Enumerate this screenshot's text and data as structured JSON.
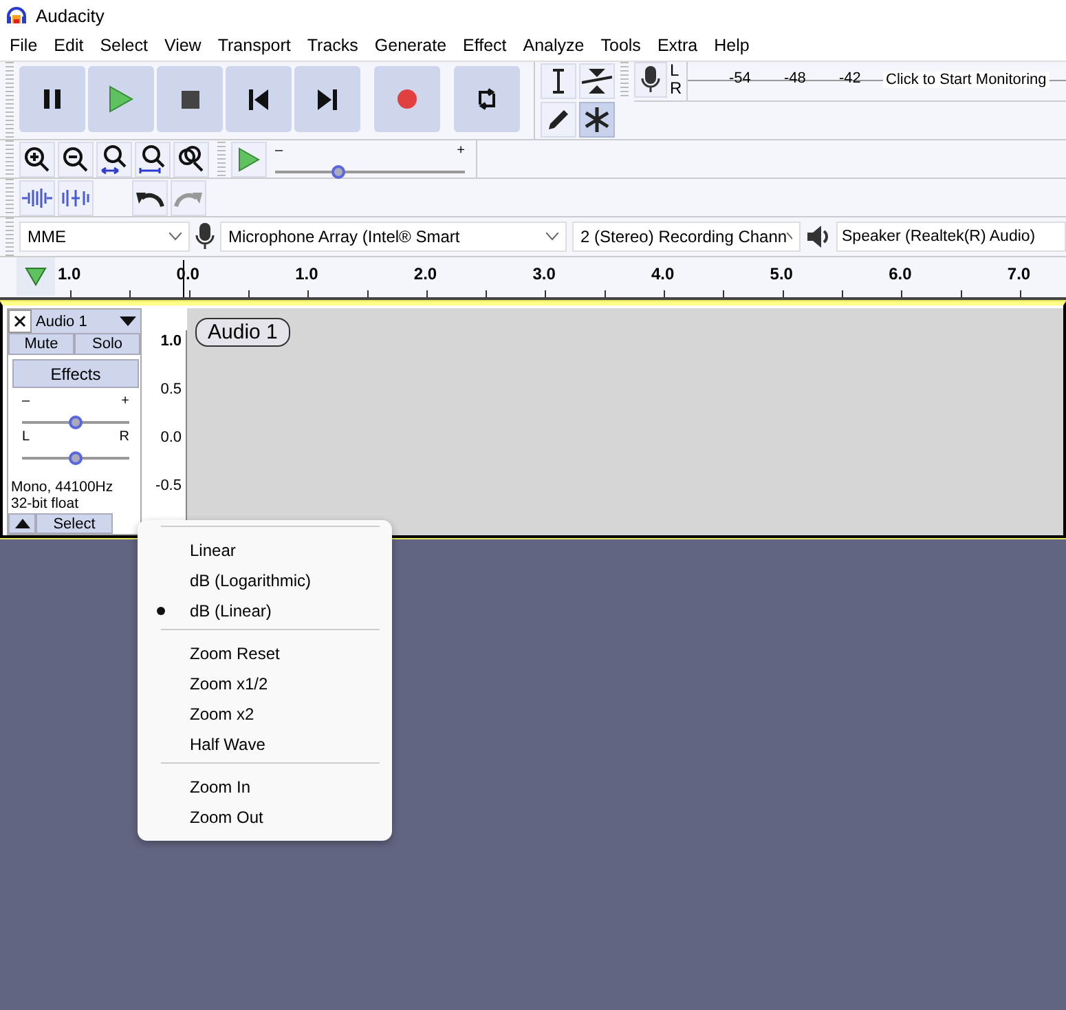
{
  "window": {
    "title": "Audacity"
  },
  "menu_bar": [
    "File",
    "Edit",
    "Select",
    "View",
    "Transport",
    "Tracks",
    "Generate",
    "Effect",
    "Analyze",
    "Tools",
    "Extra",
    "Help"
  ],
  "tools": [
    {
      "kind": "ibeam",
      "selected": false
    },
    {
      "kind": "envelope",
      "selected": false
    },
    {
      "kind": "pencil",
      "selected": false
    },
    {
      "kind": "multi",
      "selected": true
    }
  ],
  "meter": {
    "channels": [
      "L",
      "R"
    ],
    "ticks": [
      "-54",
      "-48",
      "-42"
    ],
    "prompt": "Click to Start Monitoring"
  },
  "play_speed": {
    "minus": "–",
    "plus": "+",
    "level": 0.33
  },
  "devices": {
    "host": "MME",
    "input": "Microphone Array (Intel® Smart",
    "channels": "2 (Stereo) Recording Chann",
    "output": "Speaker (Realtek(R) Audio)"
  },
  "timeline": {
    "ticks": [
      "1.0",
      "0.0",
      "1.0",
      "2.0",
      "3.0",
      "4.0",
      "5.0",
      "6.0",
      "7.0"
    ]
  },
  "track": {
    "name": "Audio 1",
    "mute": "Mute",
    "solo": "Solo",
    "effects": "Effects",
    "gain": {
      "minus": "–",
      "plus": "+",
      "level": 0.5
    },
    "pan": {
      "left": "L",
      "right": "R",
      "level": 0.5
    },
    "info": [
      "Mono, 44100Hz",
      "32-bit float"
    ],
    "select": "Select",
    "clip_name": "Audio 1",
    "scale": [
      "1.0",
      "0.5",
      "0.0",
      "-0.5"
    ]
  },
  "context_menu": {
    "groups": [
      [
        {
          "label": "Linear",
          "selected": false
        },
        {
          "label": "dB (Logarithmic)",
          "selected": false
        },
        {
          "label": "dB (Linear)",
          "selected": true
        }
      ],
      [
        {
          "label": "Zoom Reset",
          "selected": false
        },
        {
          "label": "Zoom x1/2",
          "selected": false
        },
        {
          "label": "Zoom x2",
          "selected": false
        },
        {
          "label": "Half Wave",
          "selected": false
        }
      ],
      [
        {
          "label": "Zoom In",
          "selected": false
        },
        {
          "label": "Zoom Out",
          "selected": false
        }
      ]
    ]
  }
}
